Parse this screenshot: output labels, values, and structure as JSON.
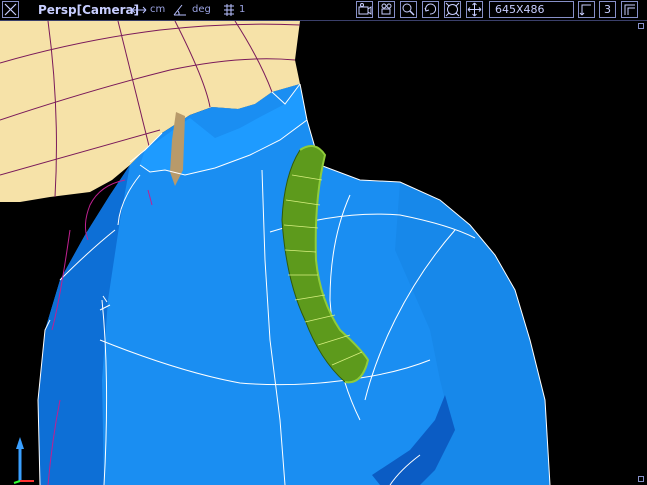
{
  "toolbar": {
    "view_label": "Persp[Camera]",
    "units_length": "cm",
    "units_angle": "deg",
    "snap_value": "1",
    "resolution": "645X486",
    "layout_count": "3"
  },
  "icons": {
    "close": "close-x-icon",
    "move_units": "double-arrow-icon",
    "angle": "angle-icon",
    "snap": "snap-grid-icon",
    "camera": "camera-icon",
    "video": "video-camera-icon",
    "zoom": "zoom-icon",
    "rotate": "rotate-icon",
    "fit": "fit-sphere-icon",
    "pan": "pan-arrows-icon",
    "layout": "layout-icon",
    "maximize": "maximize-corner-icon",
    "axis": "xyz-axis-icon"
  },
  "colors": {
    "background": "#000000",
    "garment": "#1a8ef2",
    "garment_shadow": "#0b5cc4",
    "skin": "#f6e2a8",
    "strap": "#5d9a1c",
    "wire": "#ffffff",
    "ui_accent": "#8790c8"
  }
}
